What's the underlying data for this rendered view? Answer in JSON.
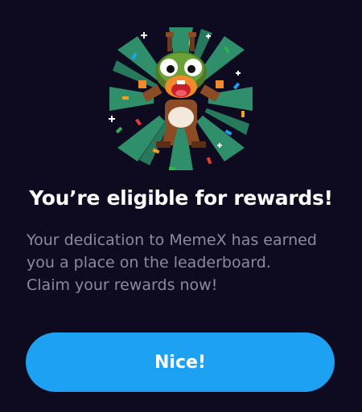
{
  "modal": {
    "illustration": {
      "icon": "celebrating-frog-mascot-icon"
    },
    "title": "You’re eligible for rewards!",
    "description_lines": [
      "Your dedication to MemeX has earned",
      "you a place on the leaderboard.",
      "Claim your rewards now!"
    ],
    "primary_button": {
      "label": "Nice!"
    }
  },
  "colors": {
    "background": "#0e0a1f",
    "accent": "#1da1f2",
    "title_text": "#ffffff",
    "body_text": "#8e8a9c",
    "burst_green": "#2f8f6b"
  }
}
